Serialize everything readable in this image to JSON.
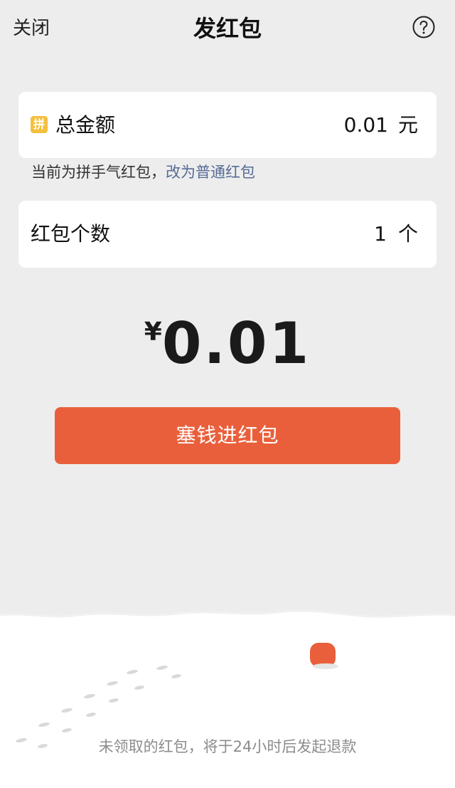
{
  "nav": {
    "close_label": "关闭",
    "title": "发红包",
    "help_icon": "question-circle-icon"
  },
  "amount_card": {
    "badge_text": "拼",
    "label": "总金额",
    "value": "0.01",
    "unit": "元"
  },
  "hint": {
    "text": "当前为拼手气红包，",
    "link": "改为普通红包"
  },
  "count_card": {
    "label": "红包个数",
    "value": "1",
    "unit": "个"
  },
  "total": {
    "currency": "¥",
    "amount": "0.01"
  },
  "submit": {
    "label": "塞钱进红包"
  },
  "footer": {
    "note": "未领取的红包，将于24小时后发起退款"
  },
  "colors": {
    "background": "#ededed",
    "card": "#ffffff",
    "accent": "#ea5f3b",
    "link": "#576b95",
    "badge": "#f4c03e"
  }
}
